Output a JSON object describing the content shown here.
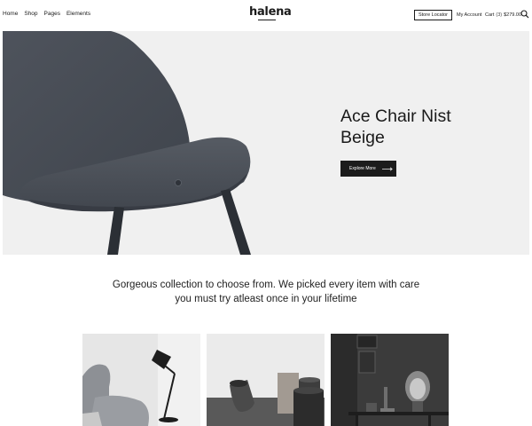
{
  "nav": {
    "items": [
      "Home",
      "Shop",
      "Pages",
      "Elements"
    ]
  },
  "logo": {
    "text": "halena"
  },
  "header": {
    "store_locator": "Store Locator",
    "my_account": "My Account",
    "cart_label": "Cart",
    "cart_count": "(3)",
    "cart_total": "$279.00",
    "search_icon": "search-icon"
  },
  "hero": {
    "title_line1": "Ace Chair Nist",
    "title_line2": "Beige",
    "button_label": "Explore More",
    "button_icon": "arrow-right-icon",
    "background_color": "#f0f0f0"
  },
  "tagline": {
    "line1": "Gorgeous collection to choose from. We picked every item with care",
    "line2": "you must try atleast once in your lifetime"
  },
  "colors": {
    "accent": "#1c1c1c",
    "text": "#1a1a1a"
  }
}
